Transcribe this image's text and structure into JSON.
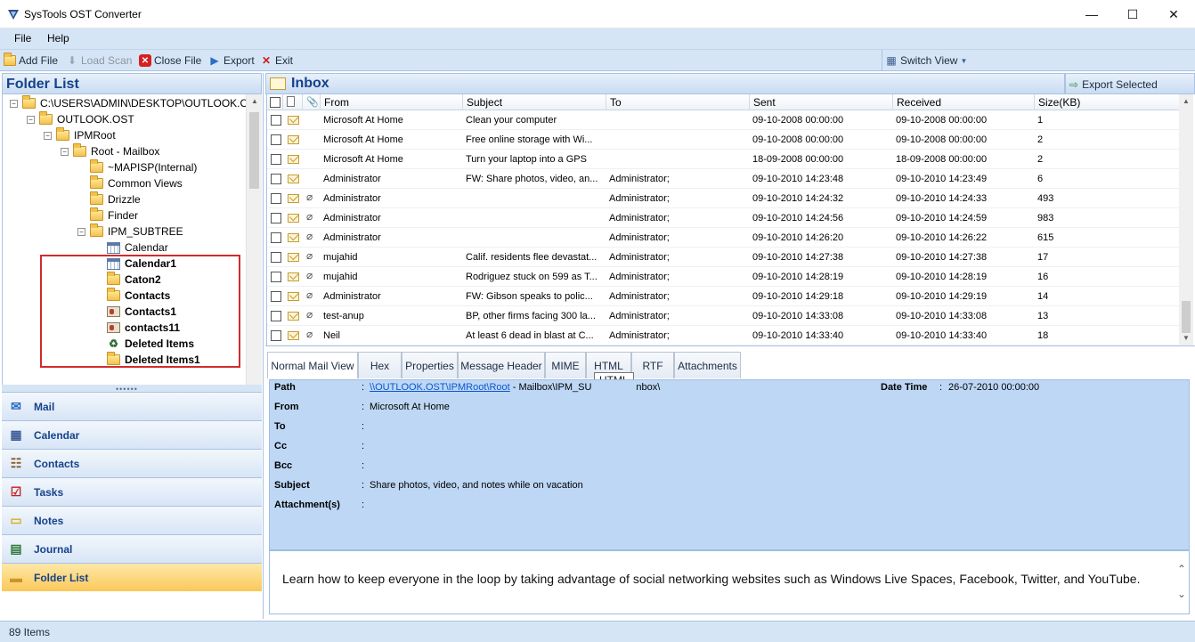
{
  "window": {
    "title": "SysTools OST Converter",
    "minimize_glyph": "—",
    "maximize_glyph": "☐",
    "close_glyph": "✕"
  },
  "menu": {
    "file": "File",
    "help": "Help"
  },
  "toolbar": {
    "add_file": "Add File",
    "load_scan": "Load Scan",
    "close_file": "Close File",
    "export": "Export",
    "exit": "Exit",
    "switch_view": "Switch View"
  },
  "folder_pane": {
    "title": "Folder List",
    "tree": [
      {
        "label": "C:\\USERS\\ADMIN\\DESKTOP\\OUTLOOK.OST",
        "icon": "folder-open-icon",
        "expander": "−",
        "bold": false
      },
      {
        "label": "OUTLOOK.OST",
        "icon": "folder-icon",
        "expander": "−",
        "bold": false
      },
      {
        "label": "IPMRoot",
        "icon": "folder-icon",
        "expander": "−",
        "bold": false
      },
      {
        "label": "Root - Mailbox",
        "icon": "folder-icon",
        "expander": "−",
        "bold": false
      },
      {
        "label": "~MAPISP(Internal)",
        "icon": "folder-icon",
        "expander": "",
        "bold": false
      },
      {
        "label": "Common Views",
        "icon": "folder-icon",
        "expander": "",
        "bold": false
      },
      {
        "label": "Drizzle",
        "icon": "folder-icon",
        "expander": "",
        "bold": false
      },
      {
        "label": "Finder",
        "icon": "folder-icon",
        "expander": "",
        "bold": false
      },
      {
        "label": "IPM_SUBTREE",
        "icon": "folder-icon",
        "expander": "−",
        "bold": false
      },
      {
        "label": "Calendar",
        "icon": "calendar-icon",
        "expander": "",
        "bold": false
      },
      {
        "label": "Calendar1",
        "icon": "calendar-icon",
        "expander": "",
        "bold": true
      },
      {
        "label": "Caton2",
        "icon": "folder-icon",
        "expander": "",
        "bold": true
      },
      {
        "label": "Contacts",
        "icon": "folder-icon",
        "expander": "",
        "bold": true
      },
      {
        "label": "Contacts1",
        "icon": "contact-card-icon",
        "expander": "",
        "bold": true
      },
      {
        "label": "contacts11",
        "icon": "contact-card-icon",
        "expander": "",
        "bold": true
      },
      {
        "label": "Deleted Items",
        "icon": "recycle-icon",
        "expander": "",
        "bold": true
      },
      {
        "label": "Deleted Items1",
        "icon": "folder-icon",
        "expander": "",
        "bold": true
      }
    ]
  },
  "nav": [
    {
      "label": "Mail",
      "icon": "mail-icon",
      "active": false
    },
    {
      "label": "Calendar",
      "icon": "calendar-icon",
      "active": false
    },
    {
      "label": "Contacts",
      "icon": "contacts-icon",
      "active": false
    },
    {
      "label": "Tasks",
      "icon": "tasks-icon",
      "active": false
    },
    {
      "label": "Notes",
      "icon": "notes-icon",
      "active": false
    },
    {
      "label": "Journal",
      "icon": "journal-icon",
      "active": false
    },
    {
      "label": "Folder List",
      "icon": "folder-list-icon",
      "active": true
    }
  ],
  "inbox": {
    "title": "Inbox",
    "export_selected": "Export Selected",
    "columns": {
      "from": "From",
      "subject": "Subject",
      "to": "To",
      "sent": "Sent",
      "received": "Received",
      "size": "Size(KB)"
    },
    "rows": [
      {
        "attach": false,
        "from": "Microsoft At Home",
        "subject": "Clean your computer",
        "to": "",
        "sent": "09-10-2008 00:00:00",
        "received": "09-10-2008 00:00:00",
        "size": "1"
      },
      {
        "attach": false,
        "from": "Microsoft At Home",
        "subject": "Free online storage with Wi...",
        "to": "",
        "sent": "09-10-2008 00:00:00",
        "received": "09-10-2008 00:00:00",
        "size": "2"
      },
      {
        "attach": false,
        "from": "Microsoft At Home",
        "subject": "Turn your laptop into a GPS",
        "to": "",
        "sent": "18-09-2008 00:00:00",
        "received": "18-09-2008 00:00:00",
        "size": "2"
      },
      {
        "attach": false,
        "from": "Administrator",
        "subject": "FW: Share photos, video, an...",
        "to": "Administrator;",
        "sent": "09-10-2010 14:23:48",
        "received": "09-10-2010 14:23:49",
        "size": "6"
      },
      {
        "attach": true,
        "from": "Administrator",
        "subject": "",
        "to": "Administrator;",
        "sent": "09-10-2010 14:24:32",
        "received": "09-10-2010 14:24:33",
        "size": "493"
      },
      {
        "attach": true,
        "from": "Administrator",
        "subject": "",
        "to": "Administrator;",
        "sent": "09-10-2010 14:24:56",
        "received": "09-10-2010 14:24:59",
        "size": "983"
      },
      {
        "attach": true,
        "from": "Administrator",
        "subject": "",
        "to": "Administrator;",
        "sent": "09-10-2010 14:26:20",
        "received": "09-10-2010 14:26:22",
        "size": "615"
      },
      {
        "attach": true,
        "from": "mujahid",
        "subject": "Calif. residents flee devastat...",
        "to": "Administrator;",
        "sent": "09-10-2010 14:27:38",
        "received": "09-10-2010 14:27:38",
        "size": "17"
      },
      {
        "attach": true,
        "from": "mujahid",
        "subject": "Rodriguez stuck on 599 as T...",
        "to": "Administrator;",
        "sent": "09-10-2010 14:28:19",
        "received": "09-10-2010 14:28:19",
        "size": "16"
      },
      {
        "attach": true,
        "from": "Administrator",
        "subject": "FW: Gibson speaks to polic...",
        "to": "Administrator;",
        "sent": "09-10-2010 14:29:18",
        "received": "09-10-2010 14:29:19",
        "size": "14"
      },
      {
        "attach": true,
        "from": "test-anup",
        "subject": "BP, other firms facing 300 la...",
        "to": "Administrator;",
        "sent": "09-10-2010 14:33:08",
        "received": "09-10-2010 14:33:08",
        "size": "13"
      },
      {
        "attach": true,
        "from": "Neil",
        "subject": "At least 6 dead in blast at C...",
        "to": "Administrator;",
        "sent": "09-10-2010 14:33:40",
        "received": "09-10-2010 14:33:40",
        "size": "18"
      }
    ]
  },
  "tabs": [
    "Normal Mail View",
    "Hex",
    "Properties",
    "Message Header",
    "MIME",
    "HTML",
    "RTF",
    "Attachments"
  ],
  "tooltip": "HTML",
  "details": {
    "path_label": "Path",
    "path_link": "\\\\OUTLOOK.OST\\IPMRoot\\Root",
    "path_rest": " - Mailbox\\IPM_SU",
    "path_tail": "nbox\\",
    "datetime_label": "Date Time",
    "datetime_value": "26-07-2010 00:00:00",
    "from_label": "From",
    "from_value": "Microsoft At Home",
    "to_label": "To",
    "cc_label": "Cc",
    "bcc_label": "Bcc",
    "subject_label": "Subject",
    "subject_value": "Share photos, video, and notes while on vacation",
    "attachments_label": "Attachment(s)",
    "colon": ":"
  },
  "body_text": "Learn how to keep everyone in the loop by taking advantage of social networking websites such as Windows Live Spaces, Facebook, Twitter, and YouTube.",
  "status": {
    "items": "89 Items"
  }
}
